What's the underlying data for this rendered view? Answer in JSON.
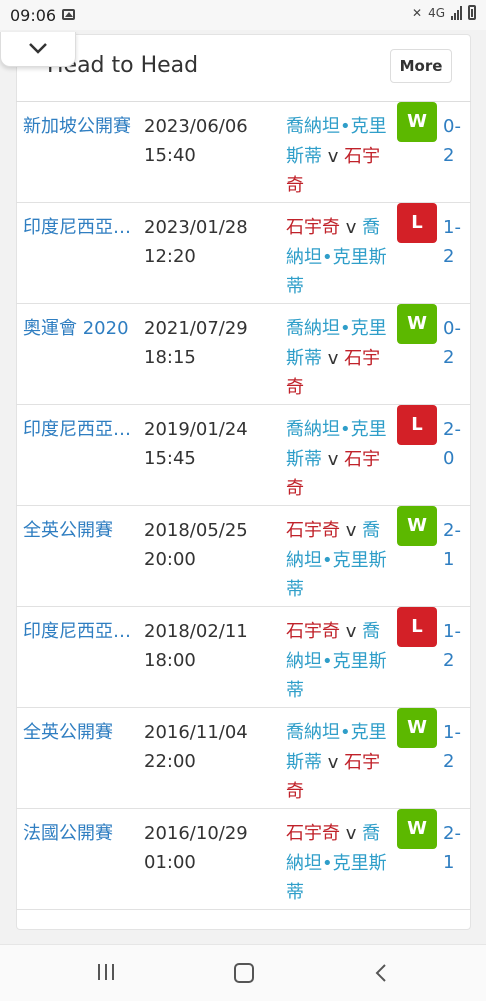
{
  "status": {
    "time": "09:06",
    "network": "4G"
  },
  "card": {
    "title": "Head to Head",
    "more_label": "More"
  },
  "colors": {
    "win": "#5cb800",
    "loss": "#d32027",
    "link": "#2f7ec1",
    "player_blue": "#2f9ec9",
    "player_red": "#c0222a"
  },
  "icons": {
    "collapse": "chevron-down-icon",
    "gallery": "image-icon",
    "nav_recent": "recent-apps-icon",
    "nav_home": "home-icon",
    "nav_back": "back-icon"
  },
  "matches": [
    {
      "tournament": "新加坡公開賽",
      "date": "2023/06/06",
      "time": "15:40",
      "first": "喬納坦•克里斯蒂",
      "second": "石宇奇",
      "vs": "v",
      "result": "W",
      "score": "0-2"
    },
    {
      "tournament": "印度尼西亞公開賽",
      "date": "2023/01/28",
      "time": "12:20",
      "first": "石宇奇",
      "second": "喬納坦•克里斯蒂",
      "vs": "v",
      "result": "L",
      "score": "1-2"
    },
    {
      "tournament": "奧運會 2020",
      "date": "2021/07/29",
      "time": "18:15",
      "first": "喬納坦•克里斯蒂",
      "second": "石宇奇",
      "vs": "v",
      "result": "W",
      "score": "0-2"
    },
    {
      "tournament": "印度尼西亞大師賽",
      "date": "2019/01/24",
      "time": "15:45",
      "first": "喬納坦•克里斯蒂",
      "second": "石宇奇",
      "vs": "v",
      "result": "L",
      "score": "2-0"
    },
    {
      "tournament": "全英公開賽",
      "date": "2018/05/25",
      "time": "20:00",
      "first": "石宇奇",
      "second": "喬納坦•克里斯蒂",
      "vs": "v",
      "result": "W",
      "score": "2-1"
    },
    {
      "tournament": "印度尼西亞大師賽",
      "date": "2018/02/11",
      "time": "18:00",
      "first": "石宇奇",
      "second": "喬納坦•克里斯蒂",
      "vs": "v",
      "result": "L",
      "score": "1-2"
    },
    {
      "tournament": "全英公開賽",
      "date": "2016/11/04",
      "time": "22:00",
      "first": "喬納坦•克里斯蒂",
      "second": "石宇奇",
      "vs": "v",
      "result": "W",
      "score": "1-2"
    },
    {
      "tournament": "法國公開賽",
      "date": "2016/10/29",
      "time": "01:00",
      "first": "石宇奇",
      "second": "喬納坦•克里斯蒂",
      "vs": "v",
      "result": "W",
      "score": "2-1"
    }
  ]
}
